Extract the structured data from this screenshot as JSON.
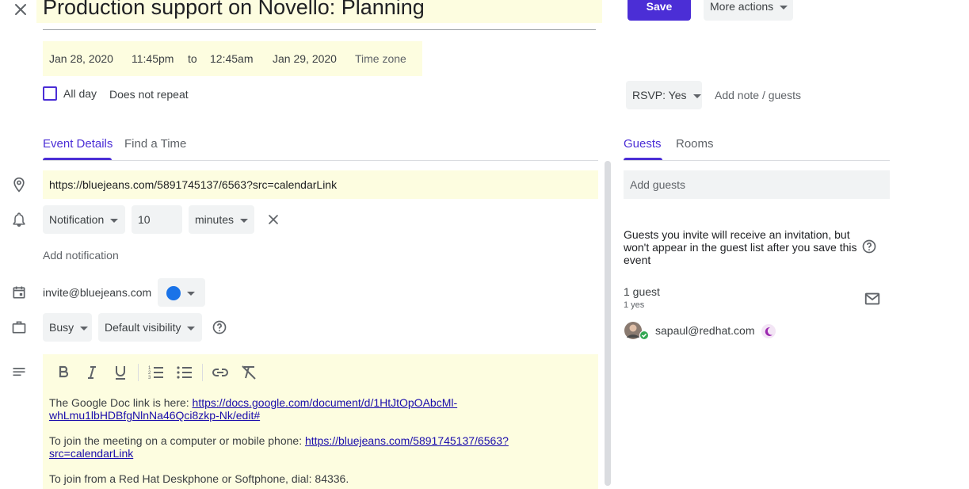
{
  "event": {
    "title": "Production support on Novello: Planning",
    "save_label": "Save",
    "more_actions_label": "More actions",
    "start_date": "Jan 28, 2020",
    "start_time": "11:45pm",
    "to_label": "to",
    "end_time": "12:45am",
    "end_date": "Jan 29, 2020",
    "timezone_label": "Time zone",
    "all_day_label": "All day",
    "repeat_label": "Does not repeat"
  },
  "rsvp": {
    "label": "RSVP: Yes",
    "add_note_label": "Add note / guests"
  },
  "tabs_left": [
    {
      "label": "Event Details",
      "active": true
    },
    {
      "label": "Find a Time",
      "active": false
    }
  ],
  "tabs_right": [
    {
      "label": "Guests",
      "active": true
    },
    {
      "label": "Rooms",
      "active": false
    }
  ],
  "details": {
    "location": "https://bluejeans.com/5891745137/6563?src=calendarLink",
    "notification_type": "Notification",
    "notification_value": "10",
    "notification_unit": "minutes",
    "add_notification_label": "Add notification",
    "calendar_name": "invite@bluejeans.com",
    "calendar_color": "#1a73e8",
    "busy_label": "Busy",
    "visibility_label": "Default visibility"
  },
  "description": {
    "line1_prefix": "The Google Doc link is here: ",
    "line1_link": "https://docs.google.com/document/d/1HtJtOpOAbcMl-whLmu1lbHDBfgNlnNa46Qci8zkp-Nk/edit#",
    "line2_prefix": "To join the meeting on a computer or mobile phone: ",
    "line2_link": "https://bluejeans.com/5891745137/6563?src=calendarLink",
    "line3": "To join from a Red Hat Deskphone or Softphone, dial: 84336."
  },
  "guests": {
    "add_placeholder": "Add guests",
    "note": "Guests you invite will receive an invitation, but won't appear in the guest list after you save this event",
    "count_label": "1 guest",
    "yes_label": "1 yes",
    "list": [
      {
        "email": "sapaul@redhat.com"
      }
    ]
  },
  "colors": {
    "accent": "#4b2ed6",
    "highlight": "#fdfde0",
    "field_bg": "#f1f3f4"
  }
}
